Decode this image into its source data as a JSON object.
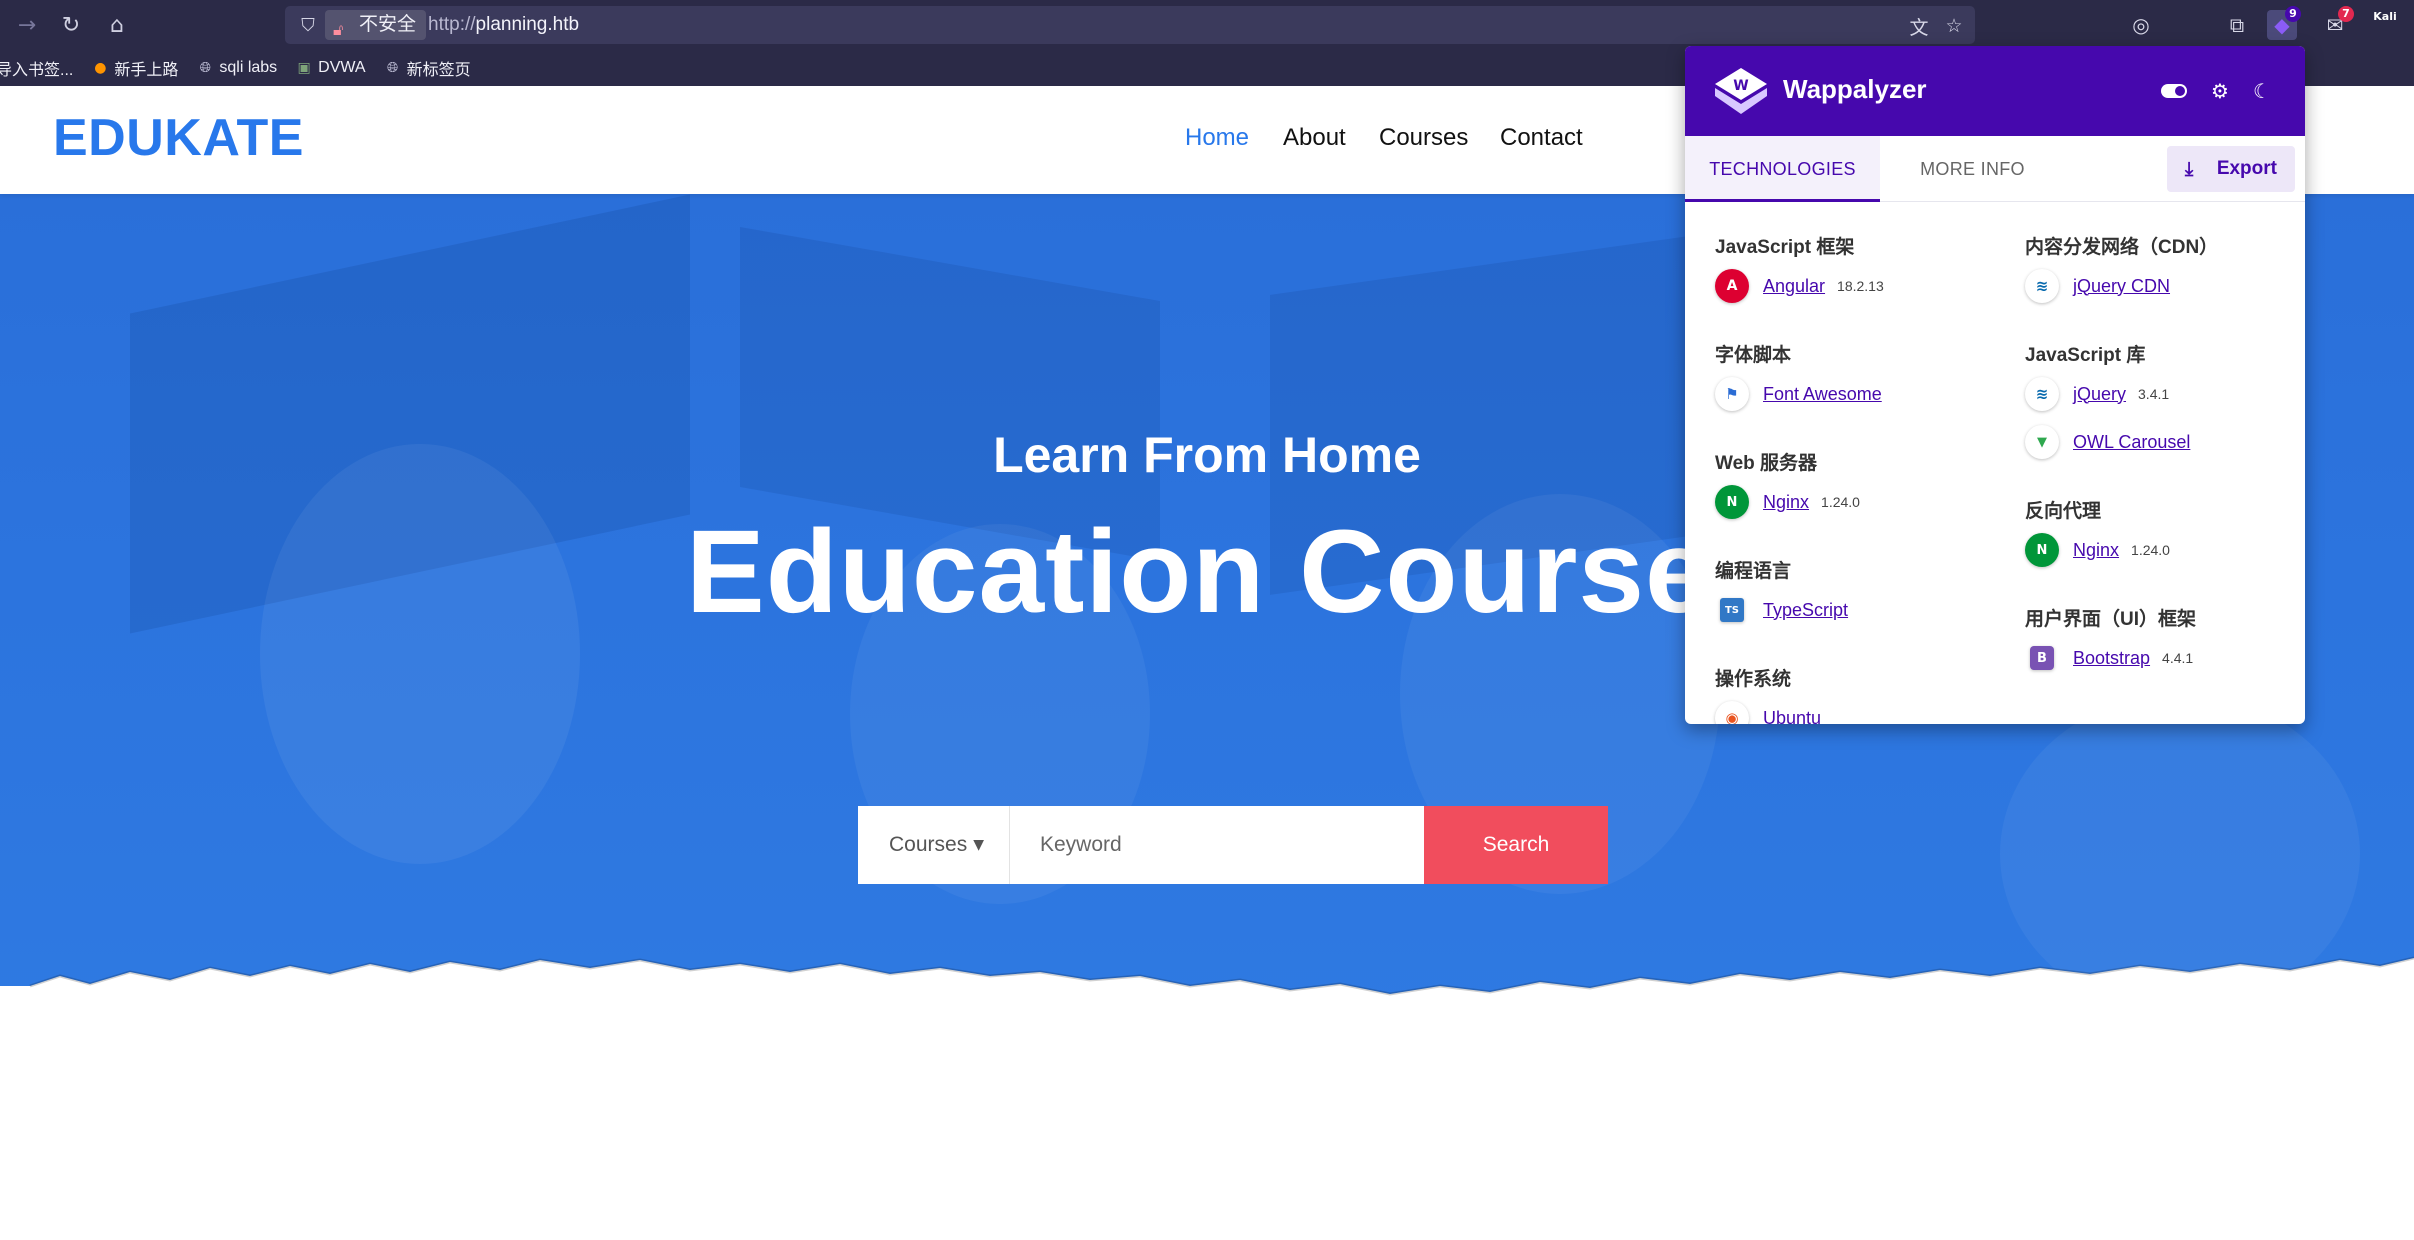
{
  "browser": {
    "security_label": "不安全",
    "url_prefix": "http://",
    "url_host": "planning.htb",
    "extension_badge_count": "9",
    "mail_badge_count": "7",
    "profile_label": "Kali",
    "bookmarks": [
      {
        "label": "导入书签...",
        "icon": "import-icon"
      },
      {
        "label": "新手上路",
        "icon": "firefox-icon"
      },
      {
        "label": "sqli labs",
        "icon": "globe-icon"
      },
      {
        "label": "DVWA",
        "icon": "page-icon"
      },
      {
        "label": "新标签页",
        "icon": "globe-icon"
      }
    ]
  },
  "site": {
    "logo": "EDUKATE",
    "nav": [
      "Home",
      "About",
      "Courses",
      "Contact"
    ],
    "hero_subtitle": "Learn From Home",
    "hero_title": "Education Courses",
    "search": {
      "category": "Courses",
      "placeholder": "Keyword",
      "button": "Search"
    },
    "colors": {
      "primary": "#2878eb",
      "search_button": "#f14d5d"
    }
  },
  "wappalyzer": {
    "title": "Wappalyzer",
    "tabs": [
      "TECHNOLOGIES",
      "MORE INFO"
    ],
    "export_label": "Export",
    "brand_color": "#4608ad",
    "left": [
      {
        "category": "JavaScript 框架",
        "items": [
          {
            "name": "Angular",
            "version": "18.2.13",
            "icon": "A",
            "icon_color": "#dd0031"
          }
        ]
      },
      {
        "category": "字体脚本",
        "items": [
          {
            "name": "Font Awesome",
            "version": "",
            "icon": "⚑",
            "icon_color": "#2b6cd4"
          }
        ]
      },
      {
        "category": "Web 服务器",
        "items": [
          {
            "name": "Nginx",
            "version": "1.24.0",
            "icon": "N",
            "icon_color": "#009639"
          }
        ]
      },
      {
        "category": "编程语言",
        "items": [
          {
            "name": "TypeScript",
            "version": "",
            "icon": "TS",
            "icon_color": "#3178c6"
          }
        ]
      },
      {
        "category": "操作系统",
        "items": [
          {
            "name": "Ubuntu",
            "version": "",
            "icon": "◉",
            "icon_color": "#e95420"
          }
        ]
      }
    ],
    "right": [
      {
        "category": "内容分发网络（CDN）",
        "items": [
          {
            "name": "jQuery CDN",
            "version": "",
            "icon": "≋",
            "icon_color": "#0769ad"
          }
        ]
      },
      {
        "category": "JavaScript 库",
        "items": [
          {
            "name": "jQuery",
            "version": "3.4.1",
            "icon": "≋",
            "icon_color": "#0769ad"
          },
          {
            "name": "OWL Carousel",
            "version": "",
            "icon": "▼",
            "icon_color": "#2fa84f"
          }
        ]
      },
      {
        "category": "反向代理",
        "items": [
          {
            "name": "Nginx",
            "version": "1.24.0",
            "icon": "N",
            "icon_color": "#009639"
          }
        ]
      },
      {
        "category": "用户界面（UI）框架",
        "items": [
          {
            "name": "Bootstrap",
            "version": "4.4.1",
            "icon": "B",
            "icon_color": "#7952b3"
          }
        ]
      }
    ]
  }
}
